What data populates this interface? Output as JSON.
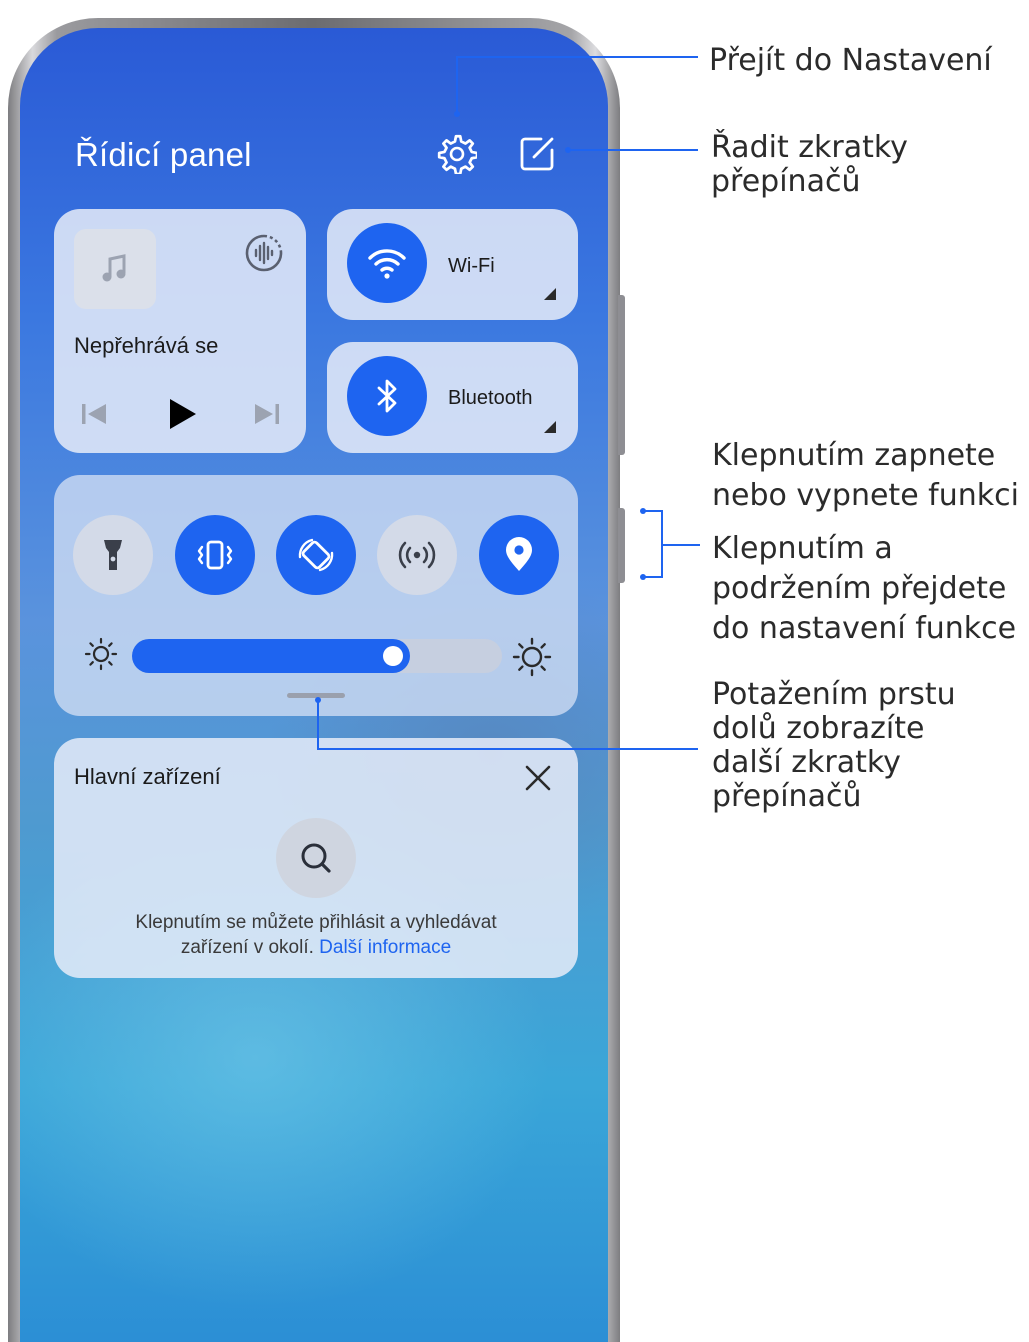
{
  "panel": {
    "title": "Řídicí panel",
    "icons": {
      "settings": "gear-icon",
      "edit": "edit-icon"
    }
  },
  "media": {
    "status": "Nepřehrává se",
    "icons": [
      "music-note-icon",
      "audio-output-icon",
      "previous-icon",
      "play-icon",
      "next-icon"
    ]
  },
  "wifi": {
    "label": "Wi-Fi",
    "state": "on"
  },
  "bluetooth": {
    "label": "Bluetooth",
    "state": "on"
  },
  "switches": [
    {
      "icon": "flashlight-icon",
      "state": "off"
    },
    {
      "icon": "vibrate-icon",
      "state": "on"
    },
    {
      "icon": "auto-rotate-icon",
      "state": "on"
    },
    {
      "icon": "nfc-icon",
      "state": "off"
    },
    {
      "icon": "location-icon",
      "state": "on"
    }
  ],
  "brightness": {
    "level": 0.75
  },
  "devices": {
    "title": "Hlavní zařízení",
    "description": "Klepnutím se můžete přihlásit a vyhledávat",
    "description_line2": "zařízení v okolí.",
    "link": "Další informace"
  },
  "callouts": {
    "settings": "Přejít do Nastavení",
    "edit_line1": "Řadit zkratky",
    "edit_line2": "přepínačů",
    "toggle_line1": "Klepnutím zapnete",
    "toggle_line2": "nebo vypnete funkci",
    "hold_line1": "Klepnutím a",
    "hold_line2": "podržením přejdete",
    "hold_line3": "do nastavení funkce",
    "drag_line1": "Potažením prstu",
    "drag_line2": "dolů zobrazíte",
    "drag_line3": "další zkratky",
    "drag_line4": "přepínačů"
  },
  "colors": {
    "accent": "#1E64F0",
    "toggle_off": "#D3DAE8",
    "callout_line": "#1E64F0",
    "callout_text": "#2B2B2B"
  }
}
